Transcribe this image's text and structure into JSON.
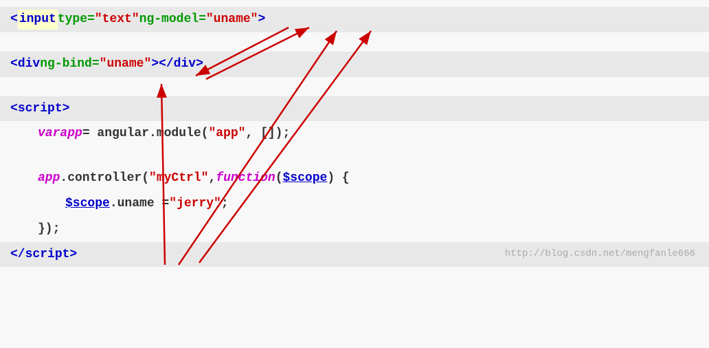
{
  "code": {
    "line1": {
      "full": "<input type=\"text\" ng-model=\"uname\">",
      "parts": [
        {
          "text": "<",
          "class": "tag-bracket"
        },
        {
          "text": "input",
          "class": "tag-name",
          "highlight": true
        },
        {
          "text": " type=",
          "class": "plain"
        },
        {
          "text": "\"text\"",
          "class": "attr-value"
        },
        {
          "text": " ng-model=",
          "class": "attr-name"
        },
        {
          "text": "\"uname\"",
          "class": "attr-value"
        },
        {
          "text": ">",
          "class": "tag-bracket"
        }
      ]
    },
    "line2": {
      "parts": [
        {
          "text": "<",
          "class": "tag-bracket"
        },
        {
          "text": "div",
          "class": "tag-name"
        },
        {
          "text": " ng-bind=",
          "class": "attr-name"
        },
        {
          "text": "\"uname\"",
          "class": "attr-value"
        },
        {
          "text": "></",
          "class": "tag-bracket"
        },
        {
          "text": "div",
          "class": "tag-name"
        },
        {
          "text": ">",
          "class": "tag-bracket"
        }
      ]
    },
    "line3": {
      "parts": [
        {
          "text": "<",
          "class": "tag-bracket"
        },
        {
          "text": "script",
          "class": "tag-name"
        },
        {
          "text": ">",
          "class": "tag-bracket"
        }
      ]
    },
    "line4": {
      "parts": [
        {
          "text": "var",
          "class": "keyword"
        },
        {
          "text": " app ",
          "class": "plain"
        },
        {
          "text": "=",
          "class": "plain"
        },
        {
          "text": " angular",
          "class": "plain"
        },
        {
          "text": ".module(",
          "class": "plain"
        },
        {
          "text": "\"app\"",
          "class": "string"
        },
        {
          "text": ", []);",
          "class": "plain"
        }
      ]
    },
    "line5": {
      "parts": [
        {
          "text": "app",
          "class": "obj-ref"
        },
        {
          "text": ".controller(",
          "class": "plain"
        },
        {
          "text": "\"myCtrl\"",
          "class": "string"
        },
        {
          "text": ", ",
          "class": "plain"
        },
        {
          "text": "function",
          "class": "keyword"
        },
        {
          "text": "(",
          "class": "plain"
        },
        {
          "text": "$scope",
          "class": "param"
        },
        {
          "text": ") {",
          "class": "plain"
        }
      ]
    },
    "line6": {
      "parts": [
        {
          "text": "$scope",
          "class": "param"
        },
        {
          "text": ".uname = ",
          "class": "plain"
        },
        {
          "text": "\"jerry\"",
          "class": "string"
        },
        {
          "text": ";",
          "class": "plain"
        }
      ]
    },
    "line7": {
      "parts": [
        {
          "text": "});",
          "class": "plain"
        }
      ]
    },
    "line8": {
      "parts": [
        {
          "text": "</",
          "class": "tag-bracket"
        },
        {
          "text": "script",
          "class": "tag-name"
        },
        {
          "text": ">",
          "class": "tag-bracket"
        }
      ]
    }
  },
  "watermark": "http://blog.csdn.net/mengfanle666"
}
